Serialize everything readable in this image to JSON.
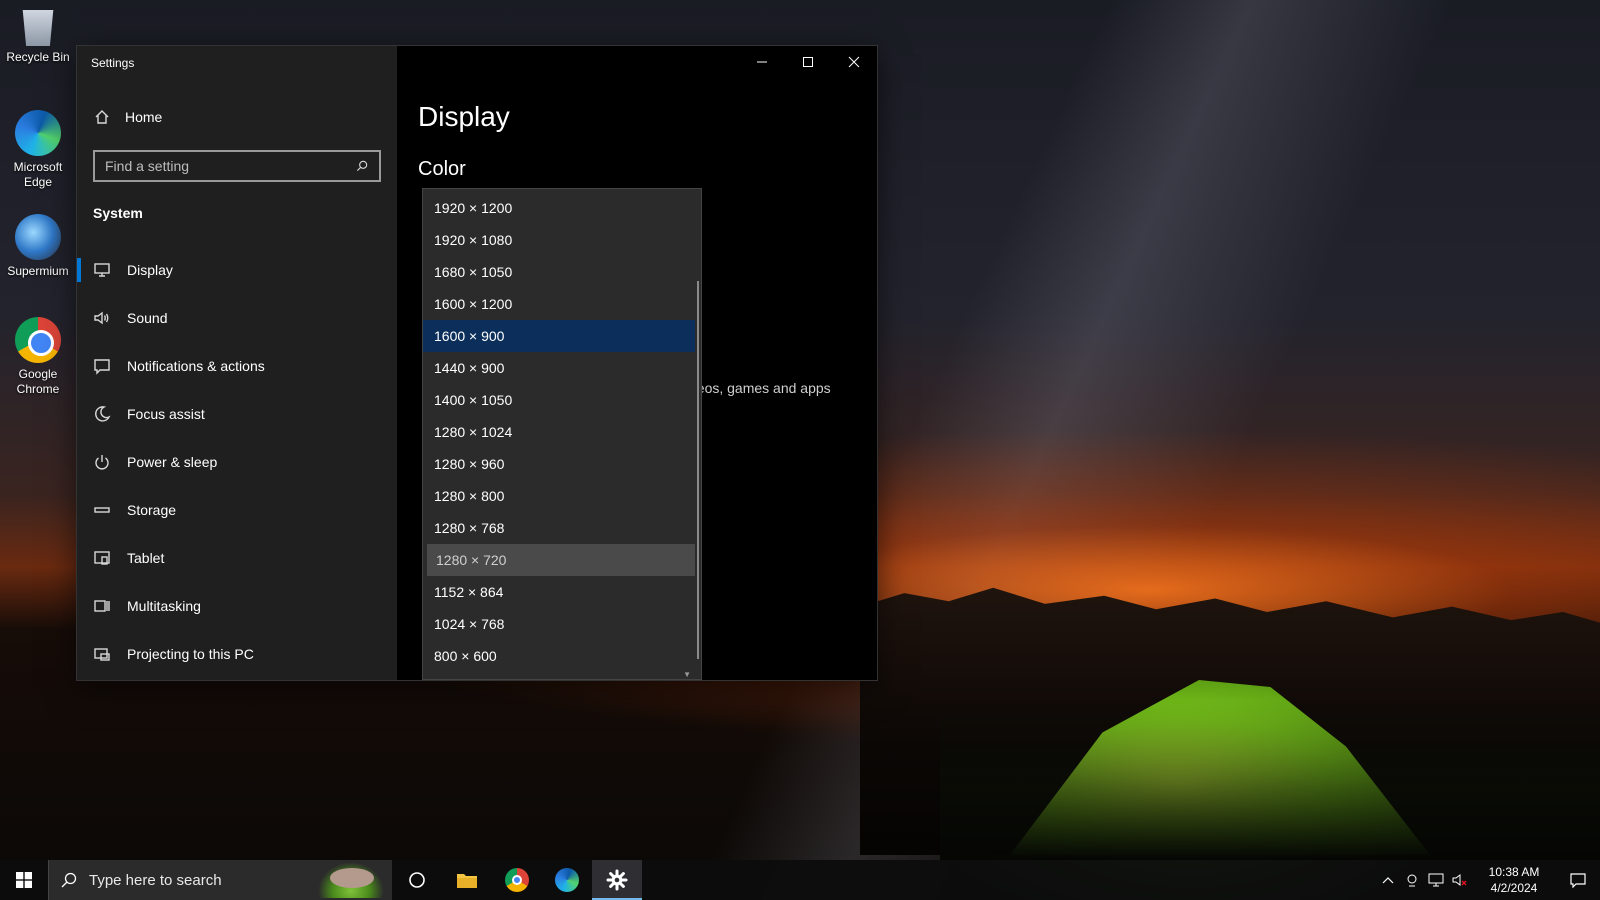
{
  "desktop": {
    "icons": [
      {
        "label": "Recycle Bin",
        "icon": "recycle-bin-icon"
      },
      {
        "label": "Microsoft Edge",
        "icon": "edge-icon"
      },
      {
        "label": "Supermium",
        "icon": "supermium-icon"
      },
      {
        "label": "Google Chrome",
        "icon": "chrome-icon"
      }
    ]
  },
  "window": {
    "title": "Settings",
    "controls": {
      "minimize": "minimize-icon",
      "maximize": "maximize-icon",
      "close": "close-icon"
    }
  },
  "sidebar": {
    "home_label": "Home",
    "search_placeholder": "Find a setting",
    "section_label": "System",
    "items": [
      {
        "label": "Display",
        "icon": "monitor-icon",
        "active": true
      },
      {
        "label": "Sound",
        "icon": "speaker-icon"
      },
      {
        "label": "Notifications & actions",
        "icon": "notification-icon"
      },
      {
        "label": "Focus assist",
        "icon": "moon-icon"
      },
      {
        "label": "Power & sleep",
        "icon": "power-icon"
      },
      {
        "label": "Storage",
        "icon": "storage-icon"
      },
      {
        "label": "Tablet",
        "icon": "tablet-icon"
      },
      {
        "label": "Multitasking",
        "icon": "multitasking-icon"
      },
      {
        "label": "Projecting to this PC",
        "icon": "projecting-icon"
      }
    ]
  },
  "content": {
    "page_title": "Display",
    "section_title": "Color",
    "partial_text": "deos, games and apps",
    "partial_mark": "s"
  },
  "resolution_dropdown": {
    "options": [
      "1920 × 1200",
      "1920 × 1080",
      "1680 × 1050",
      "1600 × 1200",
      "1600 × 900",
      "1440 × 900",
      "1400 × 1050",
      "1280 × 1024",
      "1280 × 960",
      "1280 × 800",
      "1280 × 768",
      "1280 × 720",
      "1152 × 864",
      "1024 × 768",
      "800 × 600"
    ],
    "selected": "1600 × 900",
    "hovered": "1280 × 720"
  },
  "taskbar": {
    "search_placeholder": "Type here to search",
    "apps": [
      "task-view-icon",
      "file-explorer-icon",
      "chrome-icon",
      "edge-icon",
      "settings-icon"
    ],
    "clock_time": "10:38 AM",
    "clock_date": "4/2/2024"
  },
  "colors": {
    "accent": "#0078d7",
    "selected_option": "#0b2f5a",
    "hover_option": "#4a4a4a",
    "sidebar_bg": "#1f1f1f",
    "content_bg": "#000000"
  }
}
